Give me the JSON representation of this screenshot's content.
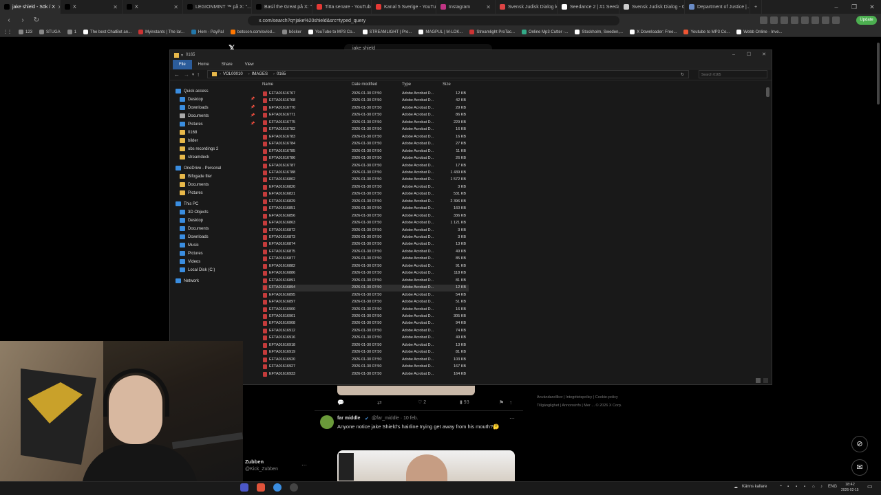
{
  "browser": {
    "tabs": [
      {
        "title": "jake shield - Sök / X",
        "color": "#000",
        "active": true
      },
      {
        "title": "X",
        "color": "#000"
      },
      {
        "title": "X",
        "color": "#000"
      },
      {
        "title": "LEGIONMINT ™ på X: \"...",
        "color": "#000"
      },
      {
        "title": "Basil the Great på X: \"u...",
        "color": "#000"
      },
      {
        "title": "Titta senare - YouTube",
        "color": "#e53935"
      },
      {
        "title": "Kanal 5 Sverige - YouTub...",
        "color": "#e53935"
      },
      {
        "title": "Instagram",
        "color": "#c13584"
      },
      {
        "title": "Svensk Judisk Dialog kan...",
        "color": "#d44"
      },
      {
        "title": "Seedance 2 | #1 Seedan...",
        "color": "#fff"
      },
      {
        "title": "Svensk Judisk Dialog - G...",
        "color": "#ccc"
      },
      {
        "title": "Department of Justice |...",
        "color": "#6a8cc7"
      }
    ],
    "url": "x.com/search?q=jake%20shield&src=typed_query",
    "update_label": "Update",
    "bookmarks": [
      {
        "label": "123",
        "color": "#888"
      },
      {
        "label": "STUGA",
        "color": "#888"
      },
      {
        "label": "1",
        "color": "#888"
      },
      {
        "label": "The best ChatBot an...",
        "color": "#fff"
      },
      {
        "label": "Myinstants | The lar...",
        "color": "#c33"
      },
      {
        "label": "Hem - PayPal",
        "color": "#27a"
      },
      {
        "label": "betsson.com/sv/od...",
        "color": "#f70"
      },
      {
        "label": "böcker",
        "color": "#888"
      },
      {
        "label": "YouTube to MP3 Co...",
        "color": "#fff"
      },
      {
        "label": "STREAMLIGHT | Pro...",
        "color": "#fff"
      },
      {
        "label": "MAGPUL | M-LOK...",
        "color": "#fff"
      },
      {
        "label": "Streamlight ProTac...",
        "color": "#c33"
      },
      {
        "label": "Online Mp3 Cutter -...",
        "color": "#3a8"
      },
      {
        "label": "Stockholm, Sweden,...",
        "color": "#fff"
      },
      {
        "label": "X Downloader: Free...",
        "color": "#fff"
      },
      {
        "label": "Youtube to MP3 Co...",
        "color": "#e53"
      },
      {
        "label": "Webb Online - Inve...",
        "color": "#fff"
      }
    ]
  },
  "x_page": {
    "search_value": "jake shield",
    "footer_links_1": "Användarvillkor | Integritetspolicy | Cookie-policy",
    "footer_links_2": "Tillgänglighet | Annonsinfo | Mer ... © 2026 X Corp.",
    "tweet": {
      "author": "far middle",
      "handle": "@far_middle · 10 feb.",
      "text": "Anyone notice jake Shield's hairline trying get away from his mouth?🤔",
      "likes": "2",
      "views": "93"
    },
    "suggested_user": {
      "name": "Zubben",
      "handle": "@Kick_Zubben"
    }
  },
  "explorer": {
    "title": "0165",
    "ribbon_tabs": [
      "File",
      "Home",
      "Share",
      "View"
    ],
    "path": [
      "VOL00010",
      "IMAGES",
      "0165"
    ],
    "search_placeholder": "Search 0165",
    "columns": [
      "Name",
      "Date modified",
      "Type",
      "Size"
    ],
    "nav": {
      "quick_access": "Quick access",
      "quick_items": [
        "Desktop",
        "Downloads",
        "Documents",
        "Pictures",
        "0168",
        "bilder",
        "obs recordings 2",
        "streamdeck"
      ],
      "onedrive": "OneDrive - Personal",
      "onedrive_items": [
        "Bifogade filer",
        "Documents",
        "Pictures"
      ],
      "this_pc": "This PC",
      "pc_items": [
        "3D Objects",
        "Desktop",
        "Documents",
        "Downloads",
        "Music",
        "Pictures",
        "Videos",
        "Local Disk (C:)"
      ],
      "network": "Network"
    },
    "files": [
      [
        "EFTA01616767",
        "2026-01-30 07:50",
        "Adobe Acrobat D...",
        "12 KB"
      ],
      [
        "EFTA01616768",
        "2026-01-30 07:50",
        "Adobe Acrobat D...",
        "42 KB"
      ],
      [
        "EFTA01616770",
        "2026-01-30 07:50",
        "Adobe Acrobat D...",
        "29 KB"
      ],
      [
        "EFTA01616771",
        "2026-01-30 07:50",
        "Adobe Acrobat D...",
        "86 KB"
      ],
      [
        "EFTA01616775",
        "2026-01-30 07:50",
        "Adobe Acrobat D...",
        "229 KB"
      ],
      [
        "EFTA01616782",
        "2026-01-30 07:50",
        "Adobe Acrobat D...",
        "16 KB"
      ],
      [
        "EFTA01616783",
        "2026-01-30 07:50",
        "Adobe Acrobat D...",
        "16 KB"
      ],
      [
        "EFTA01616784",
        "2026-01-30 07:50",
        "Adobe Acrobat D...",
        "27 KB"
      ],
      [
        "EFTA01616785",
        "2026-01-30 07:50",
        "Adobe Acrobat D...",
        "11 KB"
      ],
      [
        "EFTA01616786",
        "2026-01-30 07:50",
        "Adobe Acrobat D...",
        "26 KB"
      ],
      [
        "EFTA01616787",
        "2026-01-30 07:50",
        "Adobe Acrobat D...",
        "17 KB"
      ],
      [
        "EFTA01616788",
        "2026-01-30 07:50",
        "Adobe Acrobat D...",
        "1 439 KB"
      ],
      [
        "EFTA01616802",
        "2026-01-30 07:50",
        "Adobe Acrobat D...",
        "1 572 KB"
      ],
      [
        "EFTA01616820",
        "2026-01-30 07:50",
        "Adobe Acrobat D...",
        "3 KB"
      ],
      [
        "EFTA01616821",
        "2026-01-30 07:50",
        "Adobe Acrobat D...",
        "531 KB"
      ],
      [
        "EFTA01616829",
        "2026-01-30 07:50",
        "Adobe Acrobat D...",
        "2 396 KB"
      ],
      [
        "EFTA01616851",
        "2026-01-30 07:50",
        "Adobe Acrobat D...",
        "160 KB"
      ],
      [
        "EFTA01616856",
        "2026-01-30 07:50",
        "Adobe Acrobat D...",
        "336 KB"
      ],
      [
        "EFTA01616863",
        "2026-01-30 07:50",
        "Adobe Acrobat D...",
        "1 121 KB"
      ],
      [
        "EFTA01616872",
        "2026-01-30 07:50",
        "Adobe Acrobat D...",
        "3 KB"
      ],
      [
        "EFTA01616873",
        "2026-01-30 07:50",
        "Adobe Acrobat D...",
        "3 KB"
      ],
      [
        "EFTA01616874",
        "2026-01-30 07:50",
        "Adobe Acrobat D...",
        "13 KB"
      ],
      [
        "EFTA01616875",
        "2026-01-30 07:50",
        "Adobe Acrobat D...",
        "49 KB"
      ],
      [
        "EFTA01616877",
        "2026-01-30 07:50",
        "Adobe Acrobat D...",
        "85 KB"
      ],
      [
        "EFTA01616882",
        "2026-01-30 07:50",
        "Adobe Acrobat D...",
        "91 KB"
      ],
      [
        "EFTA01616886",
        "2026-01-30 07:50",
        "Adobe Acrobat D...",
        "118 KB"
      ],
      [
        "EFTA01616891",
        "2026-01-30 07:50",
        "Adobe Acrobat D...",
        "81 KB"
      ],
      [
        "EFTA01616894",
        "2026-01-30 07:50",
        "Adobe Acrobat D...",
        "12 KB"
      ],
      [
        "EFTA01616895",
        "2026-01-30 07:50",
        "Adobe Acrobat D...",
        "54 KB"
      ],
      [
        "EFTA01616897",
        "2026-01-30 07:50",
        "Adobe Acrobat D...",
        "51 KB"
      ],
      [
        "EFTA01616900",
        "2026-01-30 07:50",
        "Adobe Acrobat D...",
        "16 KB"
      ],
      [
        "EFTA01616901",
        "2026-01-30 07:50",
        "Adobe Acrobat D...",
        "305 KB"
      ],
      [
        "EFTA01616908",
        "2026-01-30 07:50",
        "Adobe Acrobat D...",
        "94 KB"
      ],
      [
        "EFTA01616912",
        "2026-01-30 07:50",
        "Adobe Acrobat D...",
        "74 KB"
      ],
      [
        "EFTA01616916",
        "2026-01-30 07:50",
        "Adobe Acrobat D...",
        "49 KB"
      ],
      [
        "EFTA01616918",
        "2026-01-30 07:50",
        "Adobe Acrobat D...",
        "13 KB"
      ],
      [
        "EFTA01616919",
        "2026-01-30 07:50",
        "Adobe Acrobat D...",
        "81 KB"
      ],
      [
        "EFTA01616920",
        "2026-01-30 07:50",
        "Adobe Acrobat D...",
        "103 KB"
      ],
      [
        "EFTA01616927",
        "2026-01-30 07:50",
        "Adobe Acrobat D...",
        "167 KB"
      ],
      [
        "EFTA01616933",
        "2026-01-30 07:50",
        "Adobe Acrobat D...",
        "164 KB"
      ]
    ],
    "highlight_index": 27
  },
  "taskbar": {
    "lang": "ENG",
    "time": "18:42",
    "date": "2026-02-15",
    "weather": "Känns kallare"
  },
  "colors": {
    "accent": "#2b5c9b",
    "pdf": "#c43b3b",
    "folder": "#e8b84a"
  }
}
